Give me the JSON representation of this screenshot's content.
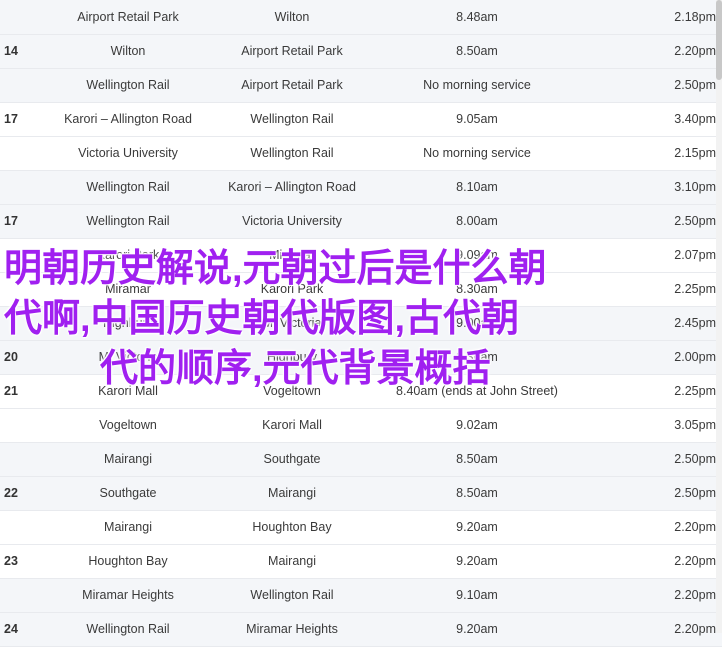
{
  "rows": [
    {
      "route": "",
      "from": "Airport Retail Park",
      "to": "Wilton",
      "arrive": "8.48am",
      "depart": "2.18pm",
      "group": "odd"
    },
    {
      "route": "14",
      "from": "Wilton",
      "to": "Airport Retail Park",
      "arrive": "8.50am",
      "depart": "2.20pm",
      "group": "odd"
    },
    {
      "route": "",
      "from": "Wellington Rail",
      "to": "Airport Retail Park",
      "arrive": "No morning service",
      "depart": "2.50pm",
      "group": "odd"
    },
    {
      "route": "17",
      "from": "Karori – Allington Road",
      "to": "Wellington Rail",
      "arrive": "9.05am",
      "depart": "3.40pm",
      "group": "even"
    },
    {
      "route": "",
      "from": "Victoria University",
      "to": "Wellington Rail",
      "arrive": "No morning service",
      "depart": "2.15pm",
      "group": "even"
    },
    {
      "route": "",
      "from": "Wellington Rail",
      "to": "Karori – Allington Road",
      "arrive": "8.10am",
      "depart": "3.10pm",
      "group": "odd"
    },
    {
      "route": "17",
      "from": "Wellington Rail",
      "to": "Victoria University",
      "arrive": "8.00am",
      "depart": "2.50pm",
      "group": "odd"
    },
    {
      "route": "",
      "from": "Karori Park",
      "to": "Miramar",
      "arrive": "9.09am",
      "depart": "2.07pm",
      "group": "even"
    },
    {
      "route": "",
      "from": "Miramar",
      "to": "Karori Park",
      "arrive": "8.30am",
      "depart": "2.25pm",
      "group": "even"
    },
    {
      "route": "",
      "from": "Highbury",
      "to": "Mt Victoria",
      "arrive": "9.00am",
      "depart": "2.45pm",
      "group": "odd"
    },
    {
      "route": "20",
      "from": "Mt Victoria",
      "to": "Highbury",
      "arrive": "8.30am",
      "depart": "2.00pm",
      "group": "odd"
    },
    {
      "route": "21",
      "from": "Karori Mall",
      "to": "Vogeltown",
      "arrive": "8.40am (ends at John Street)",
      "depart": "2.25pm",
      "group": "even"
    },
    {
      "route": "",
      "from": "Vogeltown",
      "to": "Karori Mall",
      "arrive": "9.02am",
      "depart": "3.05pm",
      "group": "even"
    },
    {
      "route": "",
      "from": "Mairangi",
      "to": "Southgate",
      "arrive": "8.50am",
      "depart": "2.50pm",
      "group": "odd"
    },
    {
      "route": "22",
      "from": "Southgate",
      "to": "Mairangi",
      "arrive": "8.50am",
      "depart": "2.50pm",
      "group": "odd"
    },
    {
      "route": "",
      "from": "Mairangi",
      "to": "Houghton Bay",
      "arrive": "9.20am",
      "depart": "2.20pm",
      "group": "even"
    },
    {
      "route": "23",
      "from": "Houghton Bay",
      "to": "Mairangi",
      "arrive": "9.20am",
      "depart": "2.20pm",
      "group": "even"
    },
    {
      "route": "",
      "from": "Miramar Heights",
      "to": "Wellington Rail",
      "arrive": "9.10am",
      "depart": "2.20pm",
      "group": "odd"
    },
    {
      "route": "24",
      "from": "Wellington Rail",
      "to": "Miramar Heights",
      "arrive": "9.20am",
      "depart": "2.20pm",
      "group": "odd"
    }
  ],
  "overlay": {
    "line1": "明朝历史解说,元朝过后是什么朝",
    "line2": "代啊,中国历史朝代版图,古代朝",
    "line3": "代的顺序,元代背景概括",
    "color": "#a020f0"
  }
}
